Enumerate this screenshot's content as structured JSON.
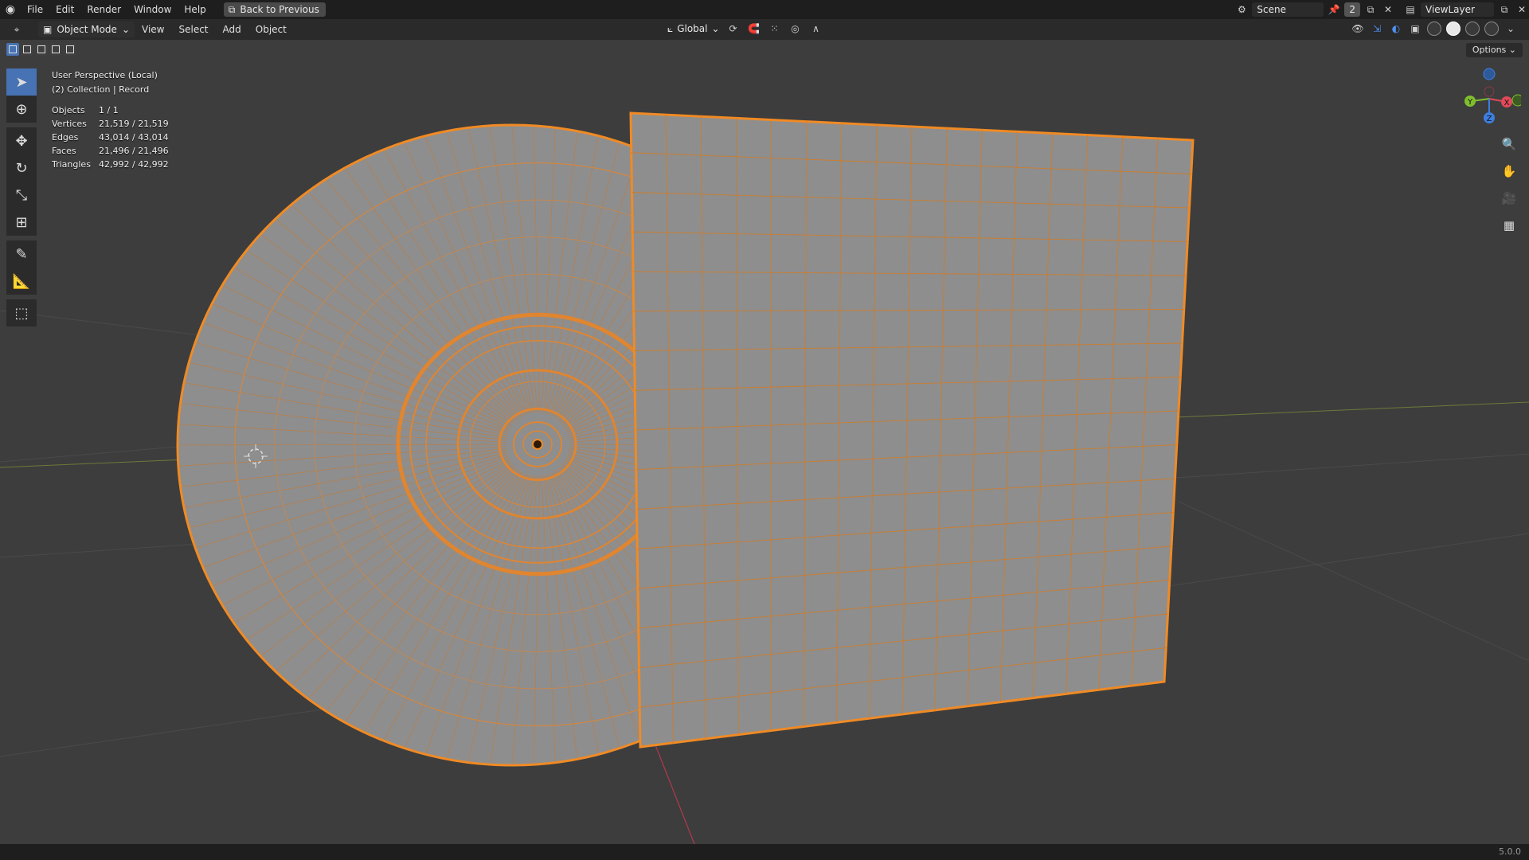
{
  "menu": {
    "items": [
      "File",
      "Edit",
      "Render",
      "Window",
      "Help"
    ],
    "back_label": "Back to Previous"
  },
  "workspace": {
    "scene_name": "Scene",
    "scene_users": "2",
    "view_layer": "ViewLayer"
  },
  "viewport_header": {
    "mode": "Object Mode",
    "menus": [
      "View",
      "Select",
      "Add",
      "Object"
    ],
    "orientation": "Global"
  },
  "options_label": "Options",
  "overlay": {
    "perspective": "User Perspective (Local)",
    "collection": "(2) Collection | Record"
  },
  "stats": [
    {
      "label": "Objects",
      "value": "1 / 1"
    },
    {
      "label": "Vertices",
      "value": "21,519 / 21,519"
    },
    {
      "label": "Edges",
      "value": "43,014 / 43,014"
    },
    {
      "label": "Faces",
      "value": "21,496 / 21,496"
    },
    {
      "label": "Triangles",
      "value": "42,992 / 42,992"
    }
  ],
  "gizmo": {
    "x": "X",
    "y": "Y",
    "z": "Z"
  },
  "version": "5.0.0",
  "colors": {
    "selection": "#f08a24",
    "mesh": "#8e8e8e",
    "viewport_bg": "#3d3d3d",
    "active_tool": "#4772b3"
  },
  "tools": [
    "select-box-icon",
    "cursor-icon",
    "move-icon",
    "rotate-icon",
    "scale-icon",
    "transform-icon",
    "annotate-icon",
    "measure-icon",
    "add-cube-icon"
  ]
}
